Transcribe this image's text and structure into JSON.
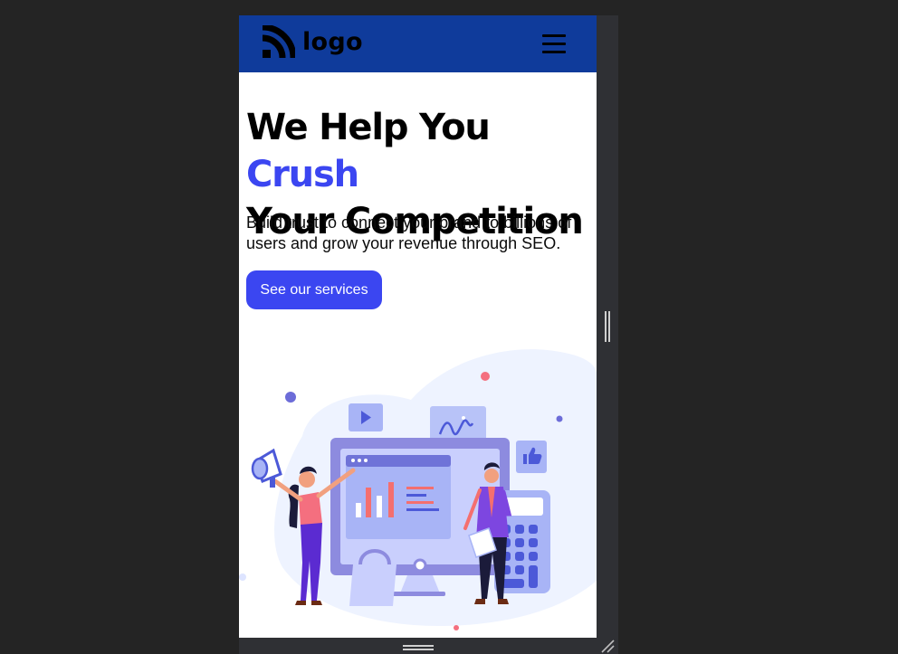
{
  "brand": {
    "logo_text": "logo",
    "nav_color": "#0f3b9b",
    "accent_color": "#3b46f1"
  },
  "nav": {
    "menu_icon": "hamburger-menu-icon"
  },
  "hero": {
    "title_part1": "We Help You ",
    "title_accent": "Crush",
    "title_part2": "Your Competition",
    "subtitle": "Build trust to connect your brand to billions of users and grow your revenue through SEO.",
    "cta_label": "See our services"
  },
  "illustration": {
    "icons": [
      "megaphone-icon",
      "play-icon",
      "analytics-chart-icon",
      "thumbs-up-icon",
      "calculator-icon",
      "shopping-bag-icon",
      "monitor-icon"
    ]
  }
}
